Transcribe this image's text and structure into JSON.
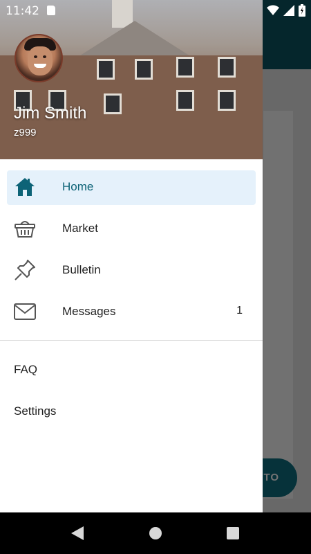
{
  "status_bar": {
    "time": "11:42"
  },
  "drawer": {
    "user": {
      "name": "Jim Smith",
      "id": "z999"
    },
    "items": [
      {
        "label": "Home",
        "icon": "home-icon",
        "active": true
      },
      {
        "label": "Market",
        "icon": "basket-icon"
      },
      {
        "label": "Bulletin",
        "icon": "pushpin-icon"
      },
      {
        "label": "Messages",
        "icon": "mail-icon",
        "count": "1"
      }
    ],
    "secondary": [
      {
        "label": "FAQ"
      },
      {
        "label": "Settings"
      }
    ]
  },
  "background": {
    "fab_text": "TO"
  },
  "colors": {
    "accent": "#0d6377",
    "toolbar": "#0d5463",
    "active_bg": "#e5f1fb"
  }
}
